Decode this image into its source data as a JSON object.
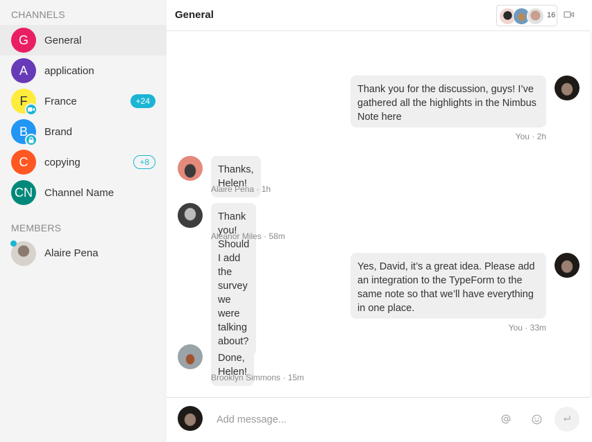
{
  "sidebar": {
    "channels_title": "CHANNELS",
    "channels": [
      {
        "initials": "G",
        "label": "General",
        "color": "#e91e63",
        "active": true
      },
      {
        "initials": "A",
        "label": "application",
        "color": "#673ab7"
      },
      {
        "initials": "F",
        "label": "France",
        "color": "#ffeb3b",
        "overlay_icon": "video-icon",
        "badge": "+24",
        "badge_style": "filled"
      },
      {
        "initials": "B",
        "label": "Brand",
        "color": "#2196f3",
        "overlay_icon": "lock-icon"
      },
      {
        "initials": "C",
        "label": "copying",
        "color": "#ff5722",
        "badge": "+8",
        "badge_style": "outline"
      },
      {
        "initials": "CN",
        "label": "Channel Name",
        "color": "#00897b"
      }
    ],
    "members_title": "MEMBERS",
    "members": [
      {
        "name": "Alaire Pena",
        "online": true
      }
    ]
  },
  "header": {
    "title": "General",
    "participants_count": "16",
    "video_icon": "video-camera-icon"
  },
  "messages": [
    {
      "author": "You",
      "time": "2h",
      "meta": "You · 2h",
      "text": "Thank you for the discussion, guys! I’ve gathered all the highlights in the Nimbus Note here",
      "own": true
    },
    {
      "author": "Alaire Pena",
      "time": "1h",
      "meta": "Alaire Pena · 1h",
      "text": "Thanks, Helen!",
      "own": false
    },
    {
      "author": "Aleanor Miles",
      "time": "58m",
      "meta": "Aleanor Miles · 58m",
      "text": "Thank you! Should I add the survey we were talking about?",
      "own": false
    },
    {
      "author": "You",
      "time": "33m",
      "meta": "You · 33m",
      "text": "Yes, David, it’s a great idea. Please add an integration to the TypeForm to the same note so that we’ll have everything in one place.",
      "own": true
    },
    {
      "author": "Brooklyn Simmons",
      "time": "15m",
      "meta": "Brooklyn Simmons · 15m",
      "text": "Done, Helen!",
      "own": false
    }
  ],
  "composer": {
    "placeholder": "Add message...",
    "value": "",
    "mention_icon": "at-icon",
    "emoji_icon": "smiley-icon",
    "send_icon": "enter-icon"
  },
  "colors": {
    "accent": "#1bb5d4",
    "bubble": "#efefef",
    "sidebar_bg": "#f4f4f4"
  }
}
